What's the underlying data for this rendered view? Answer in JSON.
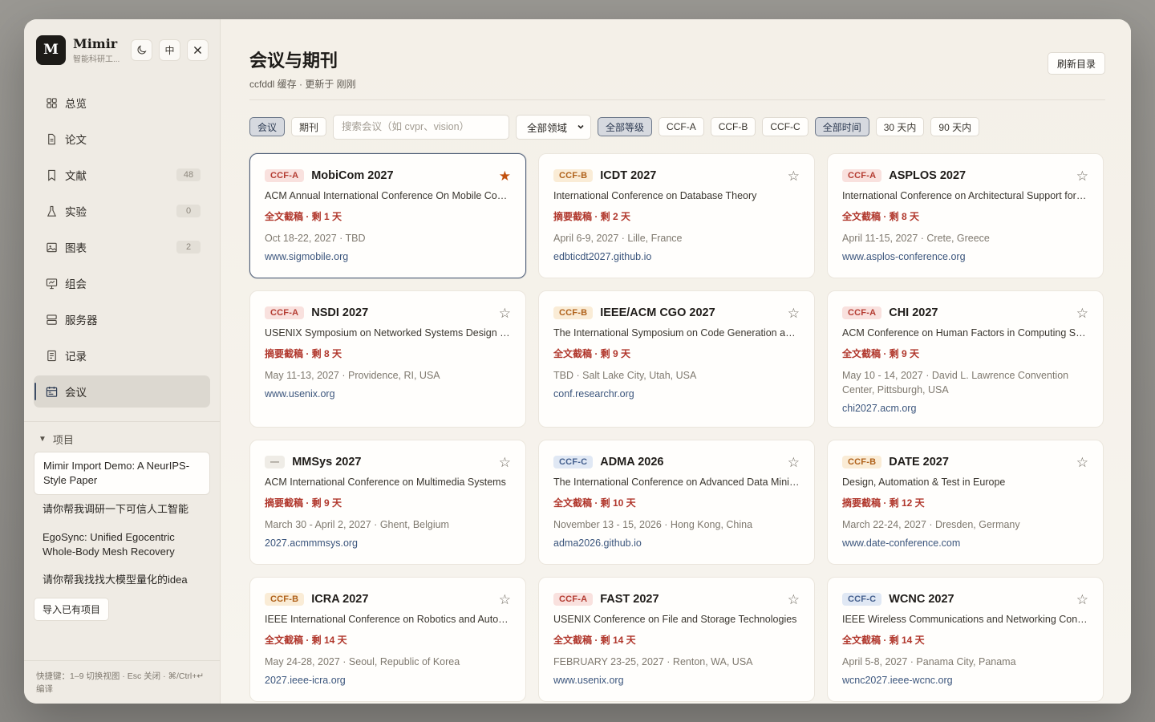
{
  "brand": {
    "logo_letter": "M",
    "name": "Mimir",
    "subtitle": "智能科研工..."
  },
  "brand_buttons": {
    "theme_icon": "moon-icon",
    "lang_label": "中",
    "close_icon": "close-icon"
  },
  "nav": [
    {
      "label": "总览",
      "icon": "grid-icon",
      "count": null
    },
    {
      "label": "论文",
      "icon": "document-icon",
      "count": null
    },
    {
      "label": "文献",
      "icon": "bookmark-icon",
      "count": "48"
    },
    {
      "label": "实验",
      "icon": "flask-icon",
      "count": "0"
    },
    {
      "label": "图表",
      "icon": "image-icon",
      "count": "2"
    },
    {
      "label": "组会",
      "icon": "presentation-icon",
      "count": null
    },
    {
      "label": "服务器",
      "icon": "server-icon",
      "count": null
    },
    {
      "label": "记录",
      "icon": "notes-icon",
      "count": null
    },
    {
      "label": "会议",
      "icon": "calendar-icon",
      "count": null,
      "active": true
    }
  ],
  "projects": {
    "heading": "项目",
    "items": [
      {
        "title": "Mimir Import Demo: A NeurIPS-Style Paper",
        "active": true
      },
      {
        "title": "请你帮我调研一下可信人工智能"
      },
      {
        "title": "EgoSync: Unified Egocentric Whole-Body Mesh Recovery"
      },
      {
        "title": "请你帮我找找大模型量化的idea"
      }
    ],
    "import_label": "导入已有项目"
  },
  "shortcut_hint": "快捷键：1–9 切换视图 · Esc 关闭 · ⌘/Ctrl+↵ 编译",
  "page": {
    "title": "会议与期刊",
    "subtitle": "ccfddl 缓存 · 更新于 刚刚",
    "refresh_label": "刷新目录"
  },
  "filters": {
    "type_conf": "会议",
    "type_journal": "期刊",
    "search_placeholder": "搜索会议（如 cvpr、vision）",
    "domain_select": "全部领域",
    "rank_all": "全部等级",
    "rank_a": "CCF-A",
    "rank_b": "CCF-B",
    "rank_c": "CCF-C",
    "time_all": "全部时间",
    "time_30": "30 天内",
    "time_90": "90 天内"
  },
  "conferences": [
    {
      "rank": "CCF-A",
      "rank_class": "a",
      "name": "MobiCom 2027",
      "full": "ACM Annual International Conference On Mobile Computing and Networking",
      "deadline": "全文截稿 · 剩 1 天",
      "when": "Oct 18-22, 2027 · TBD",
      "link": "www.sigmobile.org",
      "starred": true,
      "selected": true
    },
    {
      "rank": "CCF-B",
      "rank_class": "b",
      "name": "ICDT 2027",
      "full": "International Conference on Database Theory",
      "deadline": "摘要截稿 · 剩 2 天",
      "when": "April 6-9, 2027 · Lille, France",
      "link": "edbticdt2027.github.io"
    },
    {
      "rank": "CCF-A",
      "rank_class": "a",
      "name": "ASPLOS 2027",
      "full": "International Conference on Architectural Support for Programming Languages and Operating Systems",
      "deadline": "全文截稿 · 剩 8 天",
      "when": "April 11-15, 2027 · Crete, Greece",
      "link": "www.asplos-conference.org"
    },
    {
      "rank": "CCF-A",
      "rank_class": "a",
      "name": "NSDI 2027",
      "full": "USENIX Symposium on Networked Systems Design and Implementation",
      "deadline": "摘要截稿 · 剩 8 天",
      "when": "May 11-13, 2027 · Providence, RI, USA",
      "link": "www.usenix.org"
    },
    {
      "rank": "CCF-B",
      "rank_class": "b",
      "name": "IEEE/ACM CGO 2027",
      "full": "The International Symposium on Code Generation and Optimization",
      "deadline": "全文截稿 · 剩 9 天",
      "when": "TBD · Salt Lake City, Utah, USA",
      "link": "conf.researchr.org"
    },
    {
      "rank": "CCF-A",
      "rank_class": "a",
      "name": "CHI 2027",
      "full": "ACM Conference on Human Factors in Computing Systems",
      "deadline": "全文截稿 · 剩 9 天",
      "when": "May 10 - 14, 2027 · David L. Lawrence Convention Center, Pittsburgh, USA",
      "link": "chi2027.acm.org"
    },
    {
      "rank": "—",
      "rank_class": "none",
      "name": "MMSys 2027",
      "full": "ACM International Conference on Multimedia Systems",
      "deadline": "摘要截稿 · 剩 9 天",
      "when": "March 30 - April 2, 2027 · Ghent, Belgium",
      "link": "2027.acmmmsys.org"
    },
    {
      "rank": "CCF-C",
      "rank_class": "c",
      "name": "ADMA 2026",
      "full": "The International Conference on Advanced Data Mining and Applications",
      "deadline": "全文截稿 · 剩 10 天",
      "when": "November 13 - 15, 2026 · Hong Kong, China",
      "link": "adma2026.github.io"
    },
    {
      "rank": "CCF-B",
      "rank_class": "b",
      "name": "DATE 2027",
      "full": "Design, Automation & Test in Europe",
      "deadline": "摘要截稿 · 剩 12 天",
      "when": "March 22-24, 2027 · Dresden, Germany",
      "link": "www.date-conference.com"
    },
    {
      "rank": "CCF-B",
      "rank_class": "b",
      "name": "ICRA 2027",
      "full": "IEEE International Conference on Robotics and Automation",
      "deadline": "全文截稿 · 剩 14 天",
      "when": "May 24-28, 2027 · Seoul, Republic of Korea",
      "link": "2027.ieee-icra.org"
    },
    {
      "rank": "CCF-A",
      "rank_class": "a",
      "name": "FAST 2027",
      "full": "USENIX Conference on File and Storage Technologies",
      "deadline": "全文截稿 · 剩 14 天",
      "when": "FEBRUARY 23-25, 2027 · Renton, WA, USA",
      "link": "www.usenix.org"
    },
    {
      "rank": "CCF-C",
      "rank_class": "c",
      "name": "WCNC 2027",
      "full": "IEEE Wireless Communications and Networking Conference",
      "deadline": "全文截稿 · 剩 14 天",
      "when": "April 5-8, 2027 · Panama City, Panama",
      "link": "wcnc2027.ieee-wcnc.org"
    }
  ]
}
